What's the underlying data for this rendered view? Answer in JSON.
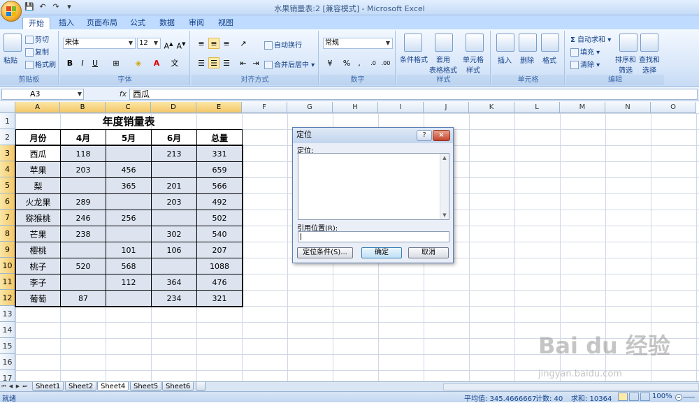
{
  "window": {
    "title": "水果销量表:2  [兼容模式] - Microsoft Excel"
  },
  "ribbon": {
    "tabs": [
      "开始",
      "插入",
      "页面布局",
      "公式",
      "数据",
      "审阅",
      "视图"
    ],
    "active_tab": "开始",
    "groups": {
      "clipboard": {
        "label": "剪贴板",
        "paste": "粘贴",
        "cut": "剪切",
        "copy": "复制",
        "format_painter": "格式刷"
      },
      "font": {
        "label": "字体",
        "font_name": "宋体",
        "font_size": "12",
        "bold": "B",
        "italic": "I",
        "underline": "U"
      },
      "alignment": {
        "label": "对齐方式",
        "wrap": "自动换行",
        "merge": "合并后居中"
      },
      "number": {
        "label": "数字",
        "format": "常规"
      },
      "styles": {
        "label": "样式",
        "cond_format": "条件格式",
        "table_format": "套用\n表格格式",
        "cell_style": "单元格\n样式"
      },
      "cells": {
        "label": "单元格",
        "insert": "插入",
        "delete": "删除",
        "format": "格式"
      },
      "editing": {
        "label": "编辑",
        "autosum": "自动求和",
        "fill": "填充",
        "clear": "清除",
        "sort": "排序和\n筛选",
        "find": "查找和\n选择"
      }
    }
  },
  "formula_bar": {
    "name_box": "A3",
    "fx": "fx",
    "content": "西瓜"
  },
  "sheet": {
    "columns": [
      "A",
      "B",
      "C",
      "D",
      "E",
      "F",
      "G",
      "H",
      "I",
      "J",
      "K",
      "L",
      "M",
      "N",
      "O"
    ],
    "rows": [
      "1",
      "2",
      "3",
      "4",
      "5",
      "6",
      "7",
      "8",
      "9",
      "10",
      "11",
      "12",
      "13",
      "14",
      "15",
      "16",
      "17"
    ],
    "table_title": "年度销量表",
    "headers": [
      "月份",
      "4月",
      "5月",
      "6月",
      "总量"
    ],
    "data": [
      [
        "西瓜",
        "118",
        "",
        "213",
        "331"
      ],
      [
        "苹果",
        "203",
        "456",
        "",
        "659"
      ],
      [
        "梨",
        "",
        "365",
        "201",
        "566"
      ],
      [
        "火龙果",
        "289",
        "",
        "203",
        "492"
      ],
      [
        "猕猴桃",
        "246",
        "256",
        "",
        "502"
      ],
      [
        "芒果",
        "238",
        "",
        "302",
        "540"
      ],
      [
        "樱桃",
        "",
        "101",
        "106",
        "207"
      ],
      [
        "桃子",
        "520",
        "568",
        "",
        "1088"
      ],
      [
        "李子",
        "",
        "112",
        "364",
        "476"
      ],
      [
        "葡萄",
        "87",
        "",
        "234",
        "321"
      ]
    ]
  },
  "dialog": {
    "title": "定位",
    "help": "?",
    "close": "×",
    "goto_label": "定位:",
    "reference_label": "引用位置(R):",
    "special_button": "定位条件(S)...",
    "ok_button": "确定",
    "cancel_button": "取消"
  },
  "sheet_tabs": [
    "Sheet1",
    "Sheet2",
    "Sheet4",
    "Sheet5",
    "Sheet6"
  ],
  "active_sheet": "Sheet4",
  "status": {
    "ready": "就绪",
    "average": "平均值: 345.4666667",
    "count": "计数: 40",
    "sum": "求和: 10364",
    "zoom": "100%"
  },
  "watermark": {
    "text": "Bai du 经验",
    "sub": "jingyan.baidu.com"
  }
}
